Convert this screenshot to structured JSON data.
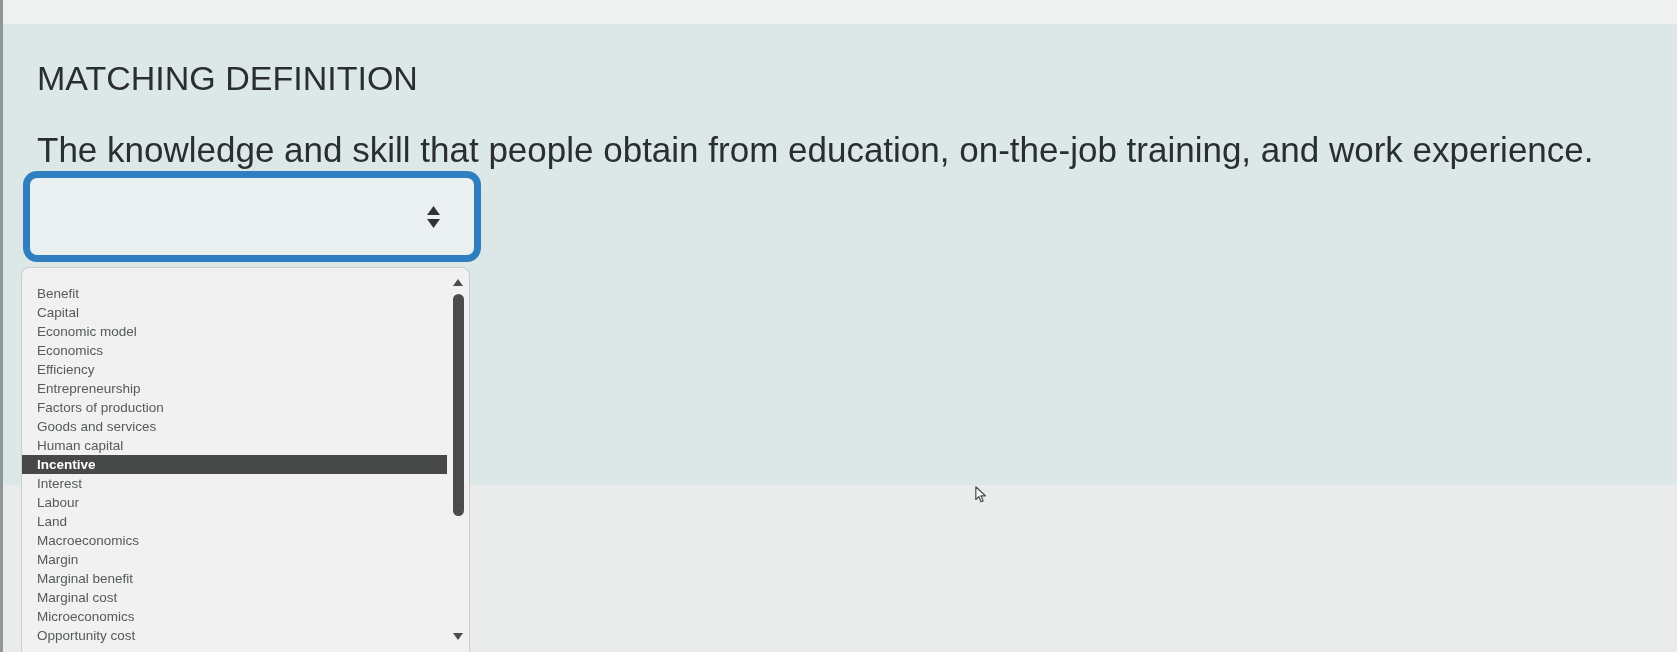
{
  "question": {
    "title": "MATCHING DEFINITION",
    "definition": "The knowledge and skill that people obtain from education, on-the-job training, and work experience."
  },
  "answer_select": {
    "focused": true,
    "expanded": true,
    "options": [
      {
        "label": "Benefit",
        "selected": false
      },
      {
        "label": "Capital",
        "selected": false
      },
      {
        "label": "Economic model",
        "selected": false
      },
      {
        "label": "Economics",
        "selected": false
      },
      {
        "label": "Efficiency",
        "selected": false
      },
      {
        "label": "Entrepreneurship",
        "selected": false
      },
      {
        "label": "Factors of production",
        "selected": false
      },
      {
        "label": "Goods and services",
        "selected": false
      },
      {
        "label": "Human capital",
        "selected": false
      },
      {
        "label": "Incentive",
        "selected": true
      },
      {
        "label": "Interest",
        "selected": false
      },
      {
        "label": "Labour",
        "selected": false
      },
      {
        "label": "Land",
        "selected": false
      },
      {
        "label": "Macroeconomics",
        "selected": false
      },
      {
        "label": "Margin",
        "selected": false
      },
      {
        "label": "Marginal benefit",
        "selected": false
      },
      {
        "label": "Marginal cost",
        "selected": false
      },
      {
        "label": "Microeconomics",
        "selected": false
      },
      {
        "label": "Opportunity cost",
        "selected": false
      }
    ]
  }
}
